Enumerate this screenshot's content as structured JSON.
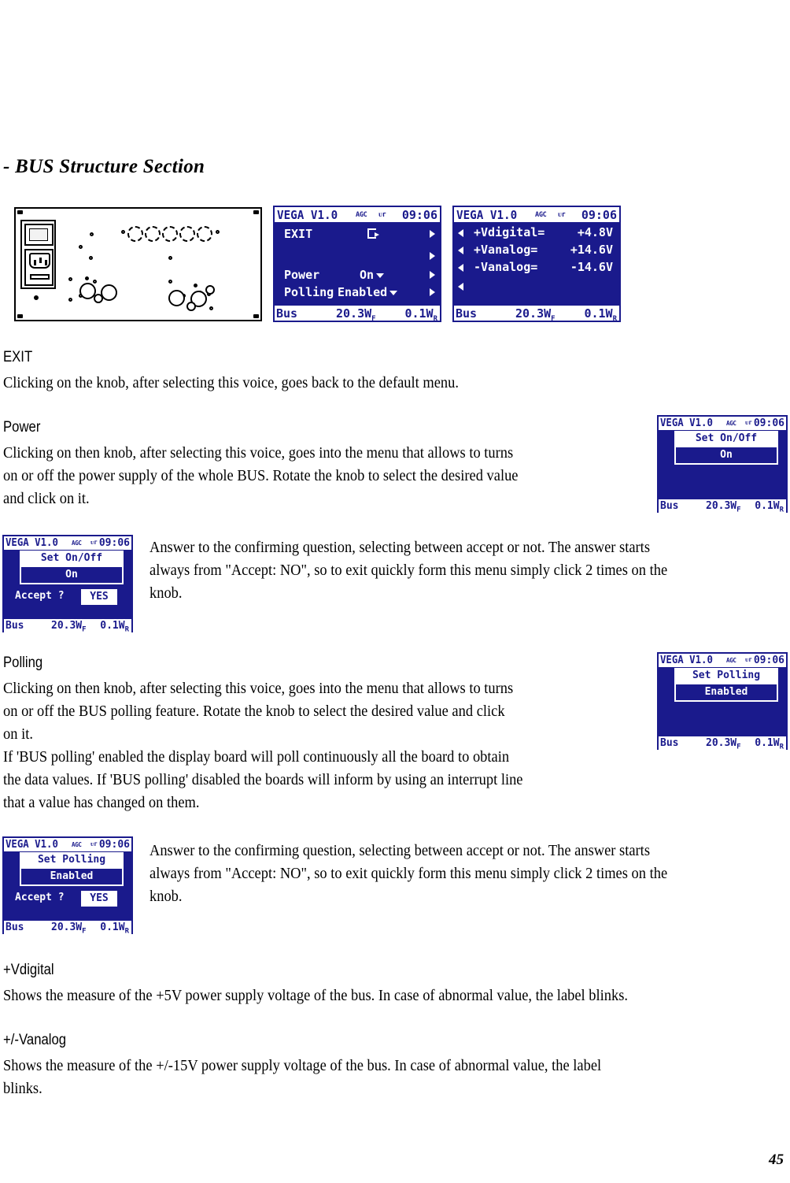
{
  "document": {
    "section_title": "- BUS Structure Section",
    "page_number": "45"
  },
  "lcd_common": {
    "brand": "VEGA V1.0",
    "agc_label": "AGC",
    "agc_symbol": "ᴜг",
    "clock": "09:06",
    "footer_bus": "Bus",
    "footer_forward": "20.3W",
    "footer_forward_sub": "F",
    "footer_reflected": "0.1W",
    "footer_reflected_sub": "R",
    "colors": {
      "lcd_blue": "#1a1a8c",
      "lcd_white": "#ffffff"
    }
  },
  "lcd_main_menu": {
    "rows": [
      {
        "label": "EXIT",
        "value": "",
        "icon": "exit-icon",
        "has_dropdown": false
      },
      {
        "label": "",
        "value": "",
        "icon": "",
        "has_dropdown": false
      },
      {
        "label": "Power",
        "value": "On",
        "icon": "",
        "has_dropdown": true
      },
      {
        "label": "Polling",
        "value": "Enabled",
        "icon": "",
        "has_dropdown": true
      }
    ]
  },
  "lcd_voltages": {
    "rows": [
      {
        "label": "+Vdigital=",
        "value": "+4.8V"
      },
      {
        "label": "+Vanalog=",
        "value": "+14.6V"
      },
      {
        "label": "-Vanalog=",
        "value": "-14.6V"
      },
      {
        "label": "",
        "value": ""
      }
    ]
  },
  "lcd_set_onoff": {
    "banner": "Set On/Off",
    "value": "On"
  },
  "lcd_set_onoff_accept": {
    "banner": "Set On/Off",
    "value": "On",
    "accept_label": "Accept ?",
    "accept_value": "YES"
  },
  "lcd_set_polling": {
    "banner": "Set Polling",
    "value": "Enabled"
  },
  "lcd_set_polling_accept": {
    "banner": "Set Polling",
    "value": "Enabled",
    "accept_label": "Accept ?",
    "accept_value": "YES"
  },
  "sections": {
    "exit": {
      "heading": "EXIT",
      "line1": "Clicking on the knob, after selecting this voice, goes back to the default menu."
    },
    "power": {
      "heading": "Power",
      "line1": "Clicking on then knob, after selecting this voice, goes into the menu that allows to turns",
      "line2": "on or off the power supply of the whole BUS. Rotate the knob to select the desired value",
      "line3": "and click on it."
    },
    "power_accept": {
      "line1": "Answer to the confirming question, selecting between accept or not. The answer starts",
      "line2": "always from \"Accept: NO\", so to exit quickly form this menu simply click 2 times on the",
      "line3": "knob."
    },
    "polling": {
      "heading": "Polling",
      "line1": "Clicking on then knob, after selecting this voice, goes into the menu that allows to turns",
      "line2": "on or off the BUS polling feature. Rotate the knob to select the desired value and click",
      "line3": "on it.",
      "line4": "If 'BUS polling' enabled the display board will poll continuously all the board to obtain",
      "line5": "the data values. If 'BUS polling' disabled the boards will inform by using an interrupt line",
      "line6": "that a value has changed on them."
    },
    "polling_accept": {
      "line1": "Answer to the confirming question, selecting between accept or not. The answer starts",
      "line2": "always from \"Accept: NO\", so to exit quickly form this menu simply click 2 times on the",
      "line3": "knob."
    },
    "vdigital": {
      "heading": "+Vdigital",
      "line1": "Shows the measure of the +5V power supply voltage of the bus. In case of abnormal value, the label blinks."
    },
    "vanalog": {
      "heading": "+/-Vanalog",
      "line1": "Shows the measure of the +/-15V power supply voltage of the bus. In case of abnormal value, the label",
      "line2": "blinks."
    }
  }
}
